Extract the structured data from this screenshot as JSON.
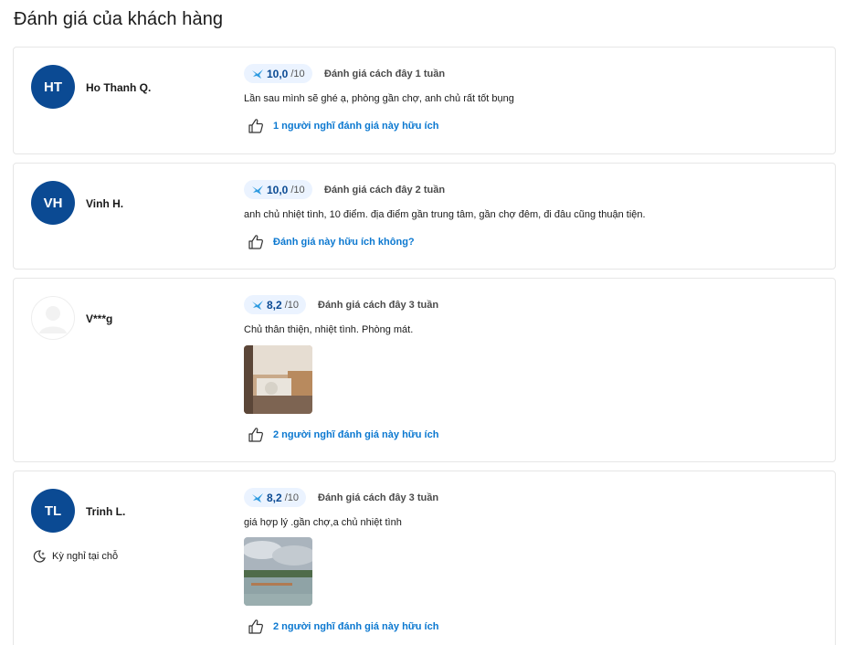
{
  "section_title": "Đánh giá của khách hàng",
  "colors": {
    "brand_blue": "#0b4a93",
    "link_blue": "#0b78d0",
    "pill_bg": "#ebf3ff"
  },
  "reviews": [
    {
      "initials": "HT",
      "name": "Ho Thanh Q.",
      "score": "10,0",
      "out_of": "/10",
      "when": "Đánh giá cách đây 1 tuần",
      "text": "Lần sau mình sẽ ghé ạ, phòng gần chợ, anh chủ rất tốt bụng",
      "helpful": "1 người nghĩ đánh giá này hữu ích"
    },
    {
      "initials": "VH",
      "name": "Vinh H.",
      "score": "10,0",
      "out_of": "/10",
      "when": "Đánh giá cách đây 2 tuần",
      "text": "anh chủ nhiệt tình, 10 điểm. địa điểm gần trung tâm, gần chợ đêm, đi đâu cũng thuận tiện.",
      "helpful": "Đánh giá này hữu ích không?"
    },
    {
      "initials": "",
      "name": "V***g",
      "score": "8,2",
      "out_of": "/10",
      "when": "Đánh giá cách đây 3 tuần",
      "text": "Chủ thân thiện, nhiệt tình. Phòng mát.",
      "helpful": "2 người nghĩ đánh giá này hữu ích"
    },
    {
      "initials": "TL",
      "name": "Trinh L.",
      "stay_type": "Kỳ nghỉ tại chỗ",
      "score": "8,2",
      "out_of": "/10",
      "when": "Đánh giá cách đây 3 tuần",
      "text": "giá hợp lý .gần chợ,a chủ nhiệt tình",
      "helpful": "2 người nghĩ đánh giá này hữu ích"
    }
  ]
}
